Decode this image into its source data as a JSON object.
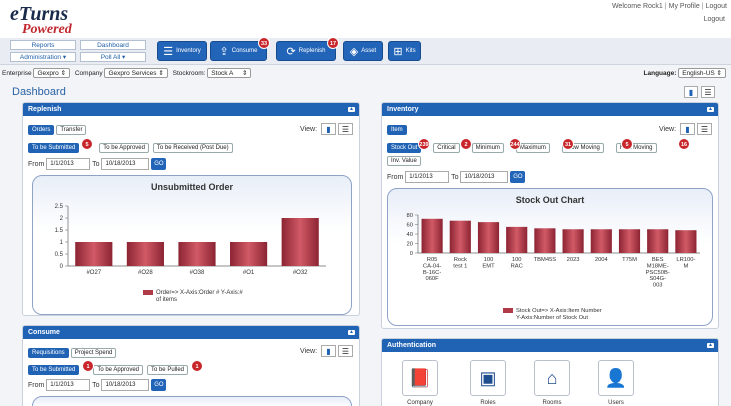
{
  "header": {
    "logo_top": "eTurns",
    "logo_bottom": "Powered",
    "welcome": "Welcome Rock1",
    "my_profile": "My Profile",
    "logout": "Logout",
    "logout_icon_label": "Logout"
  },
  "nav": {
    "reports": "Reports",
    "dashboard": "Dashboard",
    "administration": "Administration ▾",
    "poll_all": "Poll All ▾",
    "buttons": [
      {
        "label": "Inventory",
        "icon": "list-icon"
      },
      {
        "label": "Consume",
        "icon": "upload-icon",
        "badge": "33"
      },
      {
        "label": "Replenish",
        "icon": "refresh-icon",
        "badge": "17"
      },
      {
        "label": "Asset",
        "icon": "cube-icon"
      },
      {
        "label": "Kits",
        "icon": "network-icon"
      }
    ]
  },
  "filters": {
    "enterprise_label": "Enterprise",
    "enterprise": "Gexpro",
    "company_label": "Company",
    "company": "Gexpro Services",
    "stockroom_label": "Stockroom:",
    "stockroom": "Stock A",
    "language_label": "Language:",
    "language": "English-US"
  },
  "dashboard": {
    "title": "Dashboard"
  },
  "replenish": {
    "title": "Replenish",
    "tabs": [
      "Orders",
      "Transfer"
    ],
    "view_label": "View:",
    "status_tabs": [
      {
        "label": "To be Submitted",
        "badge": "5"
      },
      {
        "label": "To be Approved"
      },
      {
        "label": "To be Received (Post Due)"
      }
    ],
    "from_label": "From",
    "from": "1/1/2013",
    "to_label": "To",
    "to": "10/18/2013",
    "go": "GO"
  },
  "inventory": {
    "title": "Inventory",
    "tabs": [
      "Item"
    ],
    "view_label": "View:",
    "status_tabs": [
      {
        "label": "Stock Out",
        "badge": "239"
      },
      {
        "label": "Critical",
        "badge": "2"
      },
      {
        "label": "Minimum",
        "badge": "244"
      },
      {
        "label": "Maximum",
        "badge": "31"
      },
      {
        "label": "Slow Moving",
        "badge": "5"
      },
      {
        "label": "Fast Moving",
        "badge": "16"
      },
      {
        "label": "Inv. Value"
      }
    ],
    "from_label": "From",
    "from": "1/1/2013",
    "to_label": "To",
    "to": "10/18/2013",
    "go": "GO"
  },
  "consume": {
    "title": "Consume",
    "tabs": [
      "Requisitions",
      "Project Spend"
    ],
    "view_label": "View:",
    "status_tabs": [
      {
        "label": "To be Submitted",
        "badge": "1"
      },
      {
        "label": "To be Approved"
      },
      {
        "label": "To be Pulled",
        "badge": "1"
      }
    ],
    "from_label": "From",
    "from": "1/1/2013",
    "to_label": "To",
    "to": "10/18/2013",
    "go": "GO"
  },
  "authentication": {
    "title": "Authentication",
    "items": [
      {
        "label": "Company",
        "icon": "book-icon"
      },
      {
        "label": "Roles",
        "icon": "id-card-icon"
      },
      {
        "label": "Rooms",
        "icon": "houses-icon"
      },
      {
        "label": "Users",
        "icon": "user-icon"
      }
    ]
  },
  "chart_data": [
    {
      "type": "bar",
      "title": "Unsubmitted Order",
      "categories": [
        "#O27",
        "#O28",
        "#O38",
        "#O1",
        "#O32"
      ],
      "values": [
        1,
        1,
        1,
        1,
        2
      ],
      "ylim": [
        0,
        2.5
      ],
      "yticks": [
        0,
        0.5,
        1,
        1.5,
        2,
        2.5
      ],
      "legend": "Order=> X-Axis:Order # Y-Axis:# of items",
      "color": "#b03a48"
    },
    {
      "type": "bar",
      "title": "Stock Out Chart",
      "categories": [
        "R05 CA-04-B-16C-060F",
        "Rock test 1",
        "100 EMT",
        "100 RAC",
        "TBM45S",
        "2023",
        "2004",
        "T75M",
        "BES M18ME-PSC50B-S04G-003",
        "LR100-M"
      ],
      "values": [
        72,
        68,
        65,
        55,
        52,
        50,
        50,
        50,
        50,
        48
      ],
      "ylim": [
        0,
        80
      ],
      "yticks": [
        0,
        20,
        40,
        60,
        80
      ],
      "legend": "Stock Out=> X-Axis:Item Number Y-Axis:Number of Stock Out",
      "color": "#b03a48"
    }
  ]
}
